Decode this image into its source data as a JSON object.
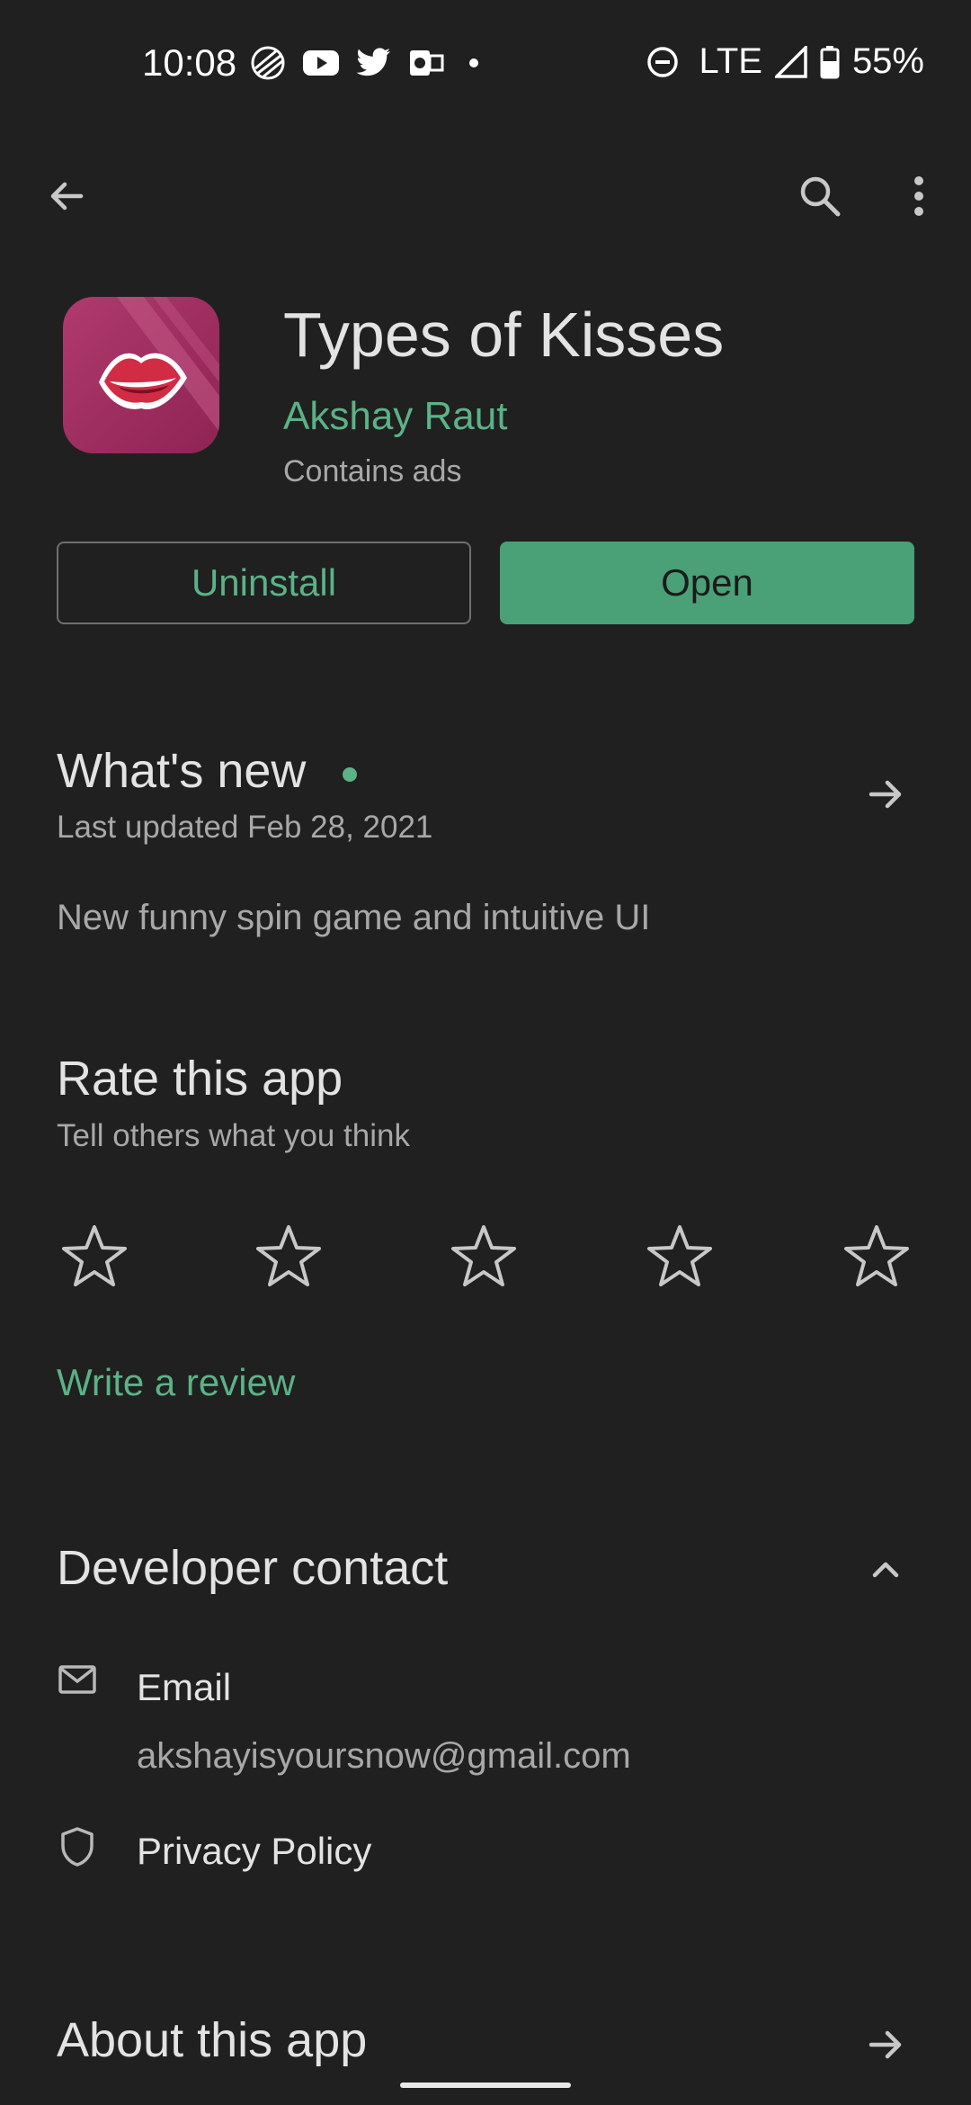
{
  "status_bar": {
    "time": "10:08",
    "network": "LTE",
    "battery": "55%",
    "icons_left": [
      "vpn-globe-icon",
      "youtube-icon",
      "twitter-icon",
      "outlook-icon",
      "dot-icon"
    ],
    "icons_right": [
      "dnd-icon",
      "signal-icon",
      "battery-icon"
    ]
  },
  "toolbar": {
    "back_icon": "arrow-left-icon",
    "search_icon": "search-icon",
    "more_icon": "more-vert-icon"
  },
  "app": {
    "title": "Types of Kisses",
    "developer": "Akshay Raut",
    "ads_note": "Contains ads",
    "uninstall_label": "Uninstall",
    "open_label": "Open"
  },
  "whats_new": {
    "title": "What's new",
    "dot_color": "#5bb287",
    "updated": "Last updated Feb 28, 2021",
    "text": "New funny spin game and intuitive UI"
  },
  "rate": {
    "title": "Rate this app",
    "subtitle": "Tell others what you think",
    "stars": 5,
    "rating_value": 0,
    "write_review": "Write a review"
  },
  "developer_contact": {
    "title": "Developer contact",
    "email_label": "Email",
    "email_value": "akshayisyoursnow@gmail.com",
    "privacy_label": "Privacy Policy"
  },
  "about": {
    "title": "About this app"
  },
  "colors": {
    "background": "#202020",
    "accent": "#5bb287",
    "primary_button": "#4aa077"
  }
}
